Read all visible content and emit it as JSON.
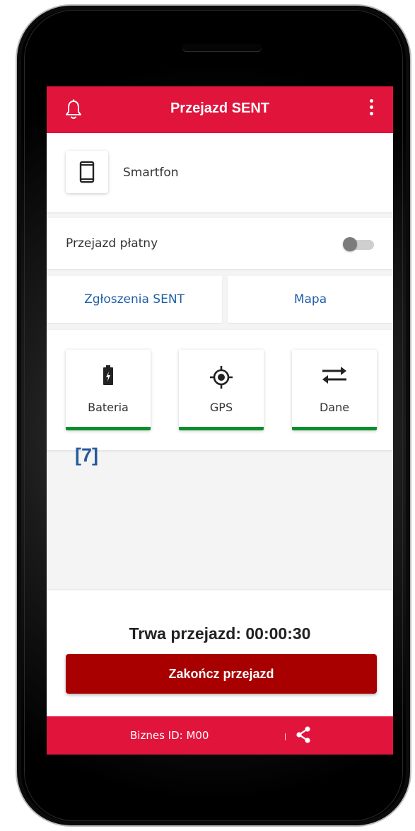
{
  "appbar": {
    "title": "Przejazd SENT",
    "bell_icon": "bell-icon",
    "menu_icon": "more-vert-icon"
  },
  "device": {
    "label": "Smartfon",
    "icon": "smartphone-icon"
  },
  "paid_trip": {
    "label": "Przejazd płatny",
    "enabled": false
  },
  "tabs": [
    {
      "label": "Zgłoszenia SENT"
    },
    {
      "label": "Mapa"
    }
  ],
  "status_tiles": [
    {
      "label": "Bateria",
      "icon": "battery-charging-icon",
      "status_color": "#0a8f2c"
    },
    {
      "label": "GPS",
      "icon": "gps-fixed-icon",
      "status_color": "#0a8f2c"
    },
    {
      "label": "Dane",
      "icon": "swap-horiz-icon",
      "status_color": "#0a8f2c"
    }
  ],
  "reference_label": "[7]",
  "trip": {
    "timer_text": "Trwa przejazd: 00:00:30",
    "end_button": "Zakończ przejazd"
  },
  "footer": {
    "business_id": "Biznes ID:  M00",
    "share_icon": "share-icon"
  },
  "colors": {
    "brand_red": "#e1143c",
    "end_button": "#a80000",
    "link_blue": "#1f5ea8",
    "ok_green": "#0a8f2c"
  }
}
